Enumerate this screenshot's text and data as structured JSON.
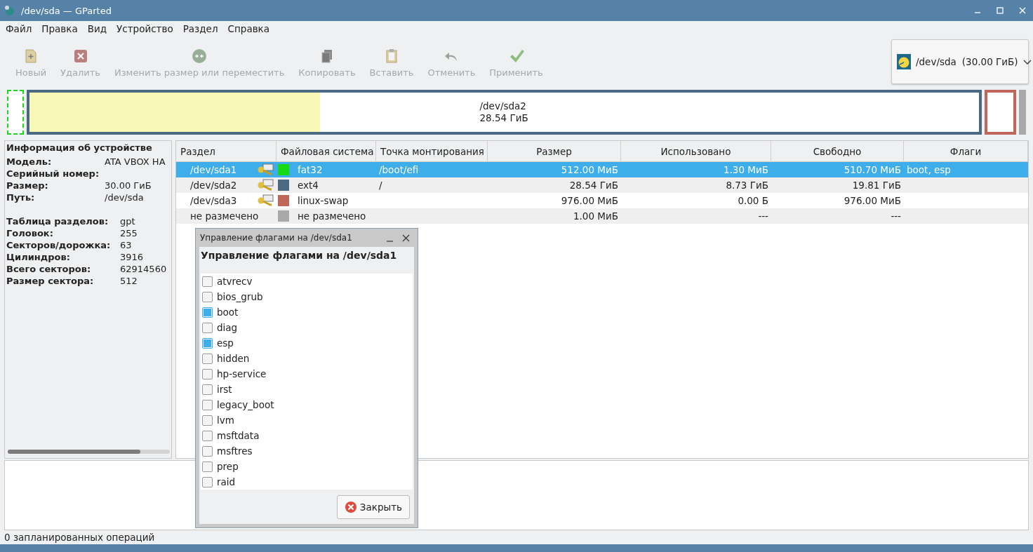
{
  "window": {
    "title": "/dev/sda — GParted"
  },
  "menu": [
    "Файл",
    "Правка",
    "Вид",
    "Устройство",
    "Раздел",
    "Справка"
  ],
  "toolbar": [
    {
      "kind": "new",
      "label": "Новый",
      "disabled": true
    },
    {
      "kind": "delete",
      "label": "Удалить",
      "disabled": true
    },
    {
      "kind": "resize",
      "label": "Изменить размер или переместить",
      "disabled": true
    },
    {
      "kind": "copy",
      "label": "Копировать",
      "disabled": true
    },
    {
      "kind": "paste",
      "label": "Вставить",
      "disabled": true
    },
    {
      "kind": "undo",
      "label": "Отменить",
      "disabled": true
    },
    {
      "kind": "apply",
      "label": "Применить",
      "disabled": true
    }
  ],
  "device_selector": {
    "device": "/dev/sda",
    "size": "(30.00 ГиБ)"
  },
  "disk_map": [
    {
      "kind": "small",
      "color": "#18d918",
      "selected": true
    },
    {
      "kind": "large",
      "color": "#4b6983",
      "selected": false,
      "level": 0.306,
      "name": "/dev/sda2",
      "size": "28.54 ГиБ"
    },
    {
      "kind": "medium",
      "color": "#c1665a",
      "selected": false
    },
    {
      "kind": "unallocated",
      "color": "#a9a9a9",
      "selected": false
    }
  ],
  "device_info": {
    "title": "Информация об устройстве",
    "groups": [
      [
        {
          "label": "Модель:",
          "value": "ATA VBOX HA"
        },
        {
          "label": "Серийный номер:"
        },
        {
          "label": "Размер:",
          "value": "30.00 ГиБ"
        },
        {
          "label": "Путь:",
          "value": "/dev/sda"
        }
      ],
      [
        {
          "label": "Таблица разделов:",
          "value": "gpt"
        },
        {
          "label": "Головок:",
          "value": "255"
        },
        {
          "label": "Секторов/дорожка:",
          "value": "63"
        },
        {
          "label": "Цилиндров:",
          "value": "3916"
        },
        {
          "label": "Всего секторов:",
          "value": "62914560"
        },
        {
          "label": "Размер сектора:",
          "value": "512"
        }
      ]
    ]
  },
  "table": {
    "columns": [
      "Раздел",
      "Файловая система",
      "Точка монтирования",
      "Размер",
      "Использовано",
      "Свободно",
      "Флаги"
    ],
    "rows": [
      {
        "partition": "/dev/sda1",
        "in_use": true,
        "color": "#18d918",
        "filesystem": "fat32",
        "mount_point": "/boot/efi",
        "size": "512.00 МиБ",
        "used": "1.30 МиБ",
        "free": "510.70 МиБ",
        "flags": "boot, esp",
        "selected": true
      },
      {
        "partition": "/dev/sda2",
        "in_use": true,
        "color": "#4b6983",
        "filesystem": "ext4",
        "mount_point": "/",
        "size": "28.54 ГиБ",
        "used": "8.73 ГиБ",
        "free": "19.81 ГиБ",
        "selected": false
      },
      {
        "partition": "/dev/sda3",
        "in_use": true,
        "color": "#c1665a",
        "filesystem": "linux-swap",
        "size": "976.00 МиБ",
        "used": "0.00 Б",
        "free": "976.00 МиБ",
        "selected": false
      },
      {
        "partition": "не размечено",
        "in_use": false,
        "color": "#a9a9a9",
        "filesystem": "не размечено",
        "size": "1.00 МиБ",
        "used": "---",
        "free": "---",
        "selected": false
      }
    ]
  },
  "flags_dialog": {
    "title": "Управление флагами на /dev/sda1",
    "heading": "Управление флагами на /dev/sda1",
    "flags": [
      {
        "label": "atvrecv",
        "checked": false
      },
      {
        "label": "bios_grub",
        "checked": false
      },
      {
        "label": "boot",
        "checked": true
      },
      {
        "label": "diag",
        "checked": false
      },
      {
        "label": "esp",
        "checked": true
      },
      {
        "label": "hidden",
        "checked": false
      },
      {
        "label": "hp-service",
        "checked": false
      },
      {
        "label": "irst",
        "checked": false
      },
      {
        "label": "legacy_boot",
        "checked": false
      },
      {
        "label": "lvm",
        "checked": false
      },
      {
        "label": "msftdata",
        "checked": false
      },
      {
        "label": "msftres",
        "checked": false
      },
      {
        "label": "prep",
        "checked": false
      },
      {
        "label": "raid",
        "checked": false
      }
    ],
    "close_button": "Закрыть"
  },
  "status_bar": "0 запланированных операций"
}
